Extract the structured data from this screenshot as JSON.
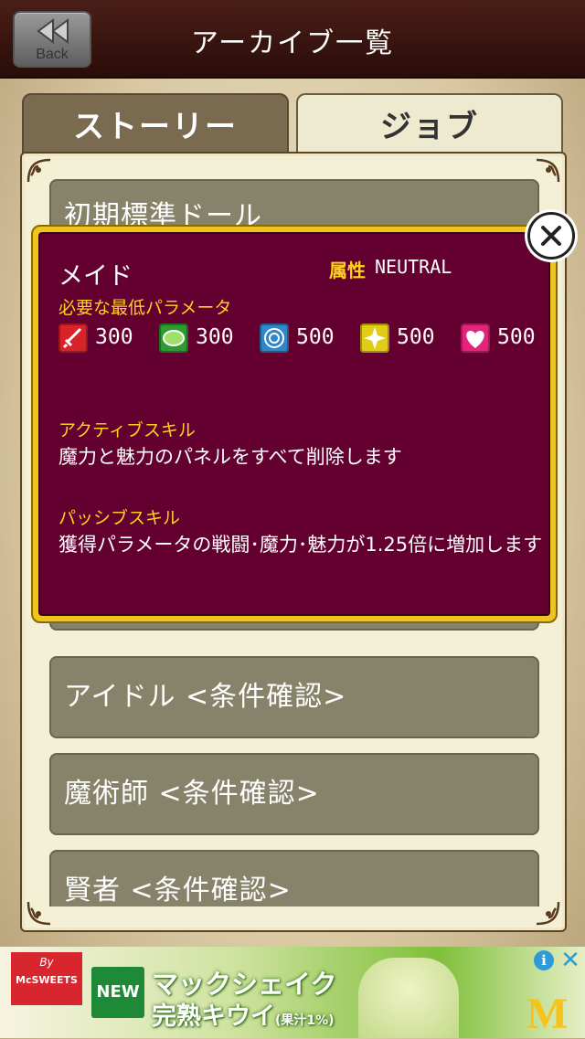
{
  "header": {
    "title": "アーカイブ一覧",
    "back_label": "Back"
  },
  "tabs": [
    {
      "label": "ストーリー",
      "active": false
    },
    {
      "label": "ジョブ",
      "active": true
    }
  ],
  "list": {
    "items": [
      {
        "label": "初期標準ドール"
      },
      {
        "label": "アイドル <条件確認>"
      },
      {
        "label": "魔術師 <条件確認>"
      },
      {
        "label": "賢者 <条件確認>"
      }
    ]
  },
  "popup": {
    "job_name": "メイド",
    "attribute_label": "属性",
    "attribute_value": "NEUTRAL",
    "required_label": "必要な最低パラメータ",
    "params": [
      {
        "icon": "sword-icon",
        "color": "#d8232a",
        "value": "300"
      },
      {
        "icon": "leaf-icon",
        "color": "#2e9a32",
        "value": "300"
      },
      {
        "icon": "magic-circle-icon",
        "color": "#2f86c8",
        "value": "500"
      },
      {
        "icon": "sparkle-icon",
        "color": "#e2cc18",
        "value": "500"
      },
      {
        "icon": "heart-icon",
        "color": "#e2247a",
        "value": "500"
      }
    ],
    "active_skill_label": "アクティブスキル",
    "active_skill_text": "魔力と魅力のパネルをすべて削除します",
    "passive_skill_label": "パッシブスキル",
    "passive_skill_text": "獲得パラメータの戦闘･魔力･魅力が1.25倍に増加します"
  },
  "ad": {
    "brand_by": "By",
    "brand_name": "McSWEETS",
    "badge": "NEW",
    "line1": "マックシェイク",
    "line2": "完熟キウイ",
    "line2_note": "(果汁1%)",
    "logo": "M",
    "info_glyph": "i",
    "close_glyph": "✕"
  },
  "colors": {
    "header_bg": "#3a140f",
    "popup_border": "#f0c41e",
    "popup_bg": "#63002f",
    "heading_yellow": "#ffd21e",
    "list_item_bg": "#87826a"
  }
}
